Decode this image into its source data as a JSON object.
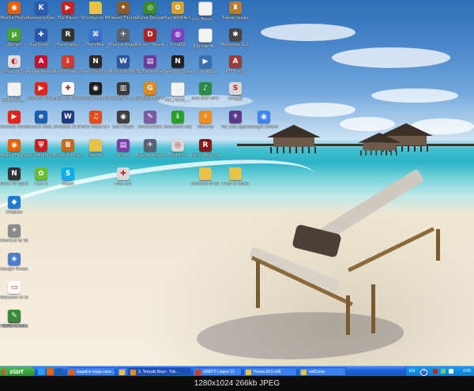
{
  "desktop": {
    "icons": [
      {
        "label": "Mozilla Firefox",
        "icon": "firefox-icon",
        "color": "#e66000",
        "glyph": "◉"
      },
      {
        "label": "Samsung Kies",
        "icon": "samsung-kies-icon",
        "color": "#2a5db0",
        "glyph": "K"
      },
      {
        "label": "FLV Player",
        "icon": "flv-player-icon",
        "color": "#cc2020",
        "glyph": "▶"
      },
      {
        "label": "Shortcut to Movies",
        "icon": "folder-icon",
        "color": "#e9c349",
        "glyph": ""
      },
      {
        "label": "Desert Thunder",
        "icon": "game-icon",
        "color": "#8c5a2b",
        "glyph": "✦"
      },
      {
        "label": "Zuma Deluxe",
        "icon": "zuma-icon",
        "color": "#3a8a2a",
        "glyph": "◎"
      },
      {
        "label": "Play Wildlife Camp",
        "icon": "game-icon",
        "color": "#d8a12a",
        "glyph": "✿"
      },
      {
        "label": "Intl_Focus_...",
        "icon": "document-icon",
        "color": "#f2f2f2",
        "glyph": ""
      },
      {
        "label": "Тайна графа",
        "icon": "game-icon",
        "color": "#b87b2a",
        "glyph": "♜"
      },
      {
        "label": "µTorrent",
        "icon": "utorrent-icon",
        "color": "#4aa32a",
        "glyph": "µ"
      },
      {
        "label": "DualCoreC...",
        "icon": "dualcore-icon",
        "color": "#2b55a8",
        "glyph": "✚"
      },
      {
        "label": "rFactorLexus",
        "icon": "rfactor-icon",
        "color": "#333333",
        "glyph": "R"
      },
      {
        "label": "TransMac",
        "icon": "transmac-icon",
        "color": "#3c6ecf",
        "glyph": "⌘"
      },
      {
        "label": "Blazing Angels Squadrons ...",
        "icon": "game-icon",
        "color": "#5a6170",
        "glyph": "✈"
      },
      {
        "label": "Driver - Parallel Lines",
        "icon": "game-icon",
        "color": "#b02222",
        "glyph": "D"
      },
      {
        "label": "UltraISO",
        "icon": "ultraiso-icon",
        "color": "#7d3fbf",
        "glyph": "◍"
      },
      {
        "label": "Zipcode_Ar...",
        "icon": "document-icon",
        "color": "#f2f2f2",
        "glyph": ""
      },
      {
        "label": "Mercedes CLC Dream Test",
        "icon": "mercedes-icon",
        "color": "#444444",
        "glyph": "✱"
      },
      {
        "label": "Virtual CD v9",
        "icon": "virtual-cd-icon",
        "color": "#dcdcdc",
        "glyph": "◐"
      },
      {
        "label": "Adobe Reader",
        "icon": "adobe-reader-icon",
        "color": "#c8102e",
        "glyph": "A"
      },
      {
        "label": "Batch Download",
        "icon": "download-icon",
        "color": "#d23a2a",
        "glyph": "⇩"
      },
      {
        "label": "Nero StartSmart",
        "icon": "nero-icon",
        "color": "#2a2a2a",
        "glyph": "N"
      },
      {
        "label": "Microsoft Office W...",
        "icon": "word-icon",
        "color": "#2b579a",
        "glyph": "W"
      },
      {
        "label": "BulFacebA.rar",
        "icon": "rar-icon",
        "color": "#6b3a9a",
        "glyph": "▤"
      },
      {
        "label": "Need For Speed Un...",
        "icon": "nfs-icon",
        "color": "#222222",
        "glyph": "N"
      },
      {
        "label": "Старт Игры",
        "icon": "game-icon",
        "color": "#3a6fb0",
        "glyph": "▶"
      },
      {
        "label": "9777.mdb",
        "icon": "access-icon",
        "color": "#a4373a",
        "glyph": "A"
      },
      {
        "label": "akon_feat_...",
        "icon": "document-icon",
        "color": "#f2f2f2",
        "glyph": ""
      },
      {
        "label": "YouTube Video Downloader",
        "icon": "youtube-icon",
        "color": "#e62117",
        "glyph": "▶"
      },
      {
        "label": "First Aid Professional",
        "icon": "first-aid-icon",
        "color": "#ffffff",
        "glyph": "✚"
      },
      {
        "label": "VirtualDJ Home",
        "icon": "virtualdj-icon",
        "color": "#1d1d1d",
        "glyph": "◉"
      },
      {
        "label": "Rectfiyan 1.36 Build 3",
        "icon": "app-icon",
        "color": "#3b3b3b",
        "glyph": "▥"
      },
      {
        "label": "Garfield Rad Bots Island 2",
        "icon": "game-icon",
        "color": "#e08a1e",
        "glyph": "G"
      },
      {
        "label": "Intl_Focus_...",
        "icon": "document-icon",
        "color": "#f2f2f2",
        "glyph": ""
      },
      {
        "label": "Free DAV MP3 Splitter",
        "icon": "app-icon",
        "color": "#2a8a4a",
        "glyph": "♪"
      },
      {
        "label": "Snaggy",
        "icon": "app-icon",
        "color": "#d8d8d8",
        "glyph": "S"
      },
      {
        "label": "YouTube Downloader",
        "icon": "youtube-icon",
        "color": "#e62117",
        "glyph": "▶"
      },
      {
        "label": "Launch Inter...",
        "icon": "internet-icon",
        "color": "#1a5fb4",
        "glyph": "e"
      },
      {
        "label": "Whataks SCIPS.0",
        "icon": "app-icon",
        "color": "#203a80",
        "glyph": "W"
      },
      {
        "label": "Free Video to MP3 Conv...",
        "icon": "app-icon",
        "color": "#e84a1a",
        "glyph": "♫"
      },
      {
        "label": "Saci Player",
        "icon": "app-icon",
        "color": "#3d3d3d",
        "glyph": "◉"
      },
      {
        "label": "SmartSelect",
        "icon": "app-icon",
        "color": "#7a5aa0",
        "glyph": "✎"
      },
      {
        "label": "Download Master",
        "icon": "download-master-icon",
        "color": "#2aa02a",
        "glyph": "⇩"
      },
      {
        "label": "Winamp",
        "icon": "winamp-icon",
        "color": "#f28c1e",
        "glyph": "⚡"
      },
      {
        "label": "My Last Apprentice",
        "icon": "game-icon",
        "color": "#5a3a8a",
        "glyph": "⚜"
      },
      {
        "label": "Google Chrome",
        "icon": "chrome-icon",
        "color": "#4285f4",
        "glyph": "◉"
      },
      {
        "label": "Mozilla Firefox",
        "icon": "firefox-icon",
        "color": "#e66000",
        "glyph": "◉"
      },
      {
        "label": "Avira AntiVir Control Center",
        "icon": "avira-icon",
        "color": "#cc1d1d",
        "glyph": "⛨"
      },
      {
        "label": "Burnout Paradise",
        "icon": "game-icon",
        "color": "#cc6a1a",
        "glyph": "B"
      },
      {
        "label": "Internet",
        "icon": "folder-icon",
        "color": "#e9c349",
        "glyph": ""
      },
      {
        "label": "Winrar",
        "icon": "winrar-icon",
        "color": "#7b3fa8",
        "glyph": "▤"
      },
      {
        "label": "Blazing Angels 2 Secret M...",
        "icon": "game-icon",
        "color": "#5a6170",
        "glyph": "✈"
      },
      {
        "label": "MagicDisc",
        "icon": "magicdisc-icon",
        "color": "#d8d8d8",
        "glyph": "◎"
      },
      {
        "label": "Rome Total War: Gold",
        "icon": "game-icon",
        "color": "#8a1a1a",
        "glyph": "R"
      },
      {
        "label": "Need for Speed: Most...",
        "icon": "nfs-icon",
        "color": "#333333",
        "glyph": "N"
      },
      {
        "label": "ICQ7.6",
        "icon": "icq-icon",
        "color": "#6cbd2a",
        "glyph": "✿"
      },
      {
        "label": "Skype",
        "icon": "skype-icon",
        "color": "#00aff0",
        "glyph": "S"
      },
      {
        "label": "Flop.exe",
        "icon": "gamepad-icon",
        "color": "#d8d8d8",
        "glyph": "✚"
      },
      {
        "label": "Shortcut to Games",
        "icon": "folder-icon",
        "color": "#e9c349",
        "glyph": ""
      },
      {
        "label": "Copy of Music",
        "icon": "folder-icon",
        "color": "#e9c349",
        "glyph": ""
      },
      {
        "label": "Dropbox",
        "icon": "dropbox-icon",
        "color": "#1f7ad6",
        "glyph": "◆"
      },
      {
        "label": "Shortcut to Yalili.exe",
        "icon": "app-icon",
        "color": "#8a8a8a",
        "glyph": "✶"
      },
      {
        "label": "Google Picasa",
        "icon": "picasa-icon",
        "color": "#4a7cc9",
        "glyph": "◈"
      },
      {
        "label": "Welcome to Google",
        "icon": "app-icon",
        "color": "#ffffff",
        "glyph": "▭"
      },
      {
        "label": "Tomb Raider",
        "icon": "game-icon",
        "color": "#6b5a3a",
        "glyph": "T"
      },
      {
        "label": "World of Goo",
        "icon": "game-icon",
        "color": "#2a2a2a",
        "glyph": "●"
      },
      {
        "label": "Shortcut to MySQL",
        "icon": "mysql-icon",
        "color": "#3a8a3a",
        "glyph": "✎"
      }
    ]
  },
  "taskbar": {
    "start_label": "start",
    "quick_launch": [
      {
        "icon": "desktop-icon",
        "color": "#2a9df4"
      },
      {
        "icon": "firefox-icon",
        "color": "#e66000"
      },
      {
        "icon": "ie-icon",
        "color": "#1a5fb4"
      }
    ],
    "tasks": [
      {
        "label": "кидайте сюда свои ...",
        "icon": "firefox-icon",
        "color": "#e66000"
      },
      {
        "label": "",
        "icon": "explorer-icon",
        "color": "#e9c349"
      },
      {
        "label": "3. Teriyaki Boyz - Tok...",
        "icon": "winamp-icon",
        "color": "#f28c1e"
      },
      {
        "label": "ABBYY Lingvo 12",
        "icon": "lingvo-icon",
        "color": "#d23a2a"
      },
      {
        "label": "House.M.D.s06",
        "icon": "folder-icon",
        "color": "#e9c349"
      },
      {
        "label": "oldComp",
        "icon": "folder-icon",
        "color": "#e9c349"
      }
    ],
    "tray": {
      "language": "EN",
      "help": "?",
      "clock": "0:00",
      "icons": [
        {
          "icon": "shield-icon",
          "color": "#cc1d1d"
        },
        {
          "icon": "network-icon",
          "color": "#6fd06f"
        },
        {
          "icon": "volume-icon",
          "color": "#ffffff"
        }
      ]
    }
  },
  "caption": "1280x1024 266kb JPEG"
}
